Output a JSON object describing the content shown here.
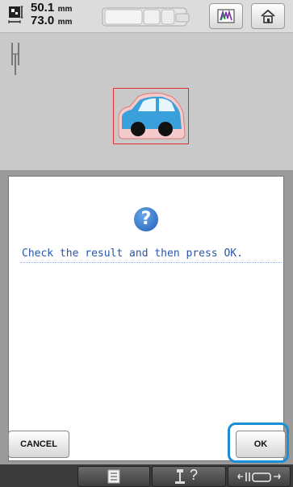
{
  "topbar": {
    "width_value": "50.1",
    "height_value": "73.0",
    "unit": "mm",
    "icons": [
      "embroidery-size-icon",
      "thread-spool-icon",
      "thread-color-icon",
      "home-icon"
    ]
  },
  "preview": {
    "design": "car-embroidery-design",
    "frame_color": "#e03030"
  },
  "dialog": {
    "icon": "question-icon",
    "question_glyph": "?",
    "message": "Check the result and then press OK.",
    "cancel_label": "CANCEL",
    "ok_label": "OK",
    "highlight_color": "#1b8fd6"
  },
  "bottombar": {
    "icons": [
      "checklist-icon",
      "help-icon",
      "sewing-machine-icon"
    ],
    "help_glyph": "?"
  },
  "colors": {
    "accent_blue": "#2a55a8",
    "car_body": "#3aa0dc",
    "wheel": "#111111"
  }
}
